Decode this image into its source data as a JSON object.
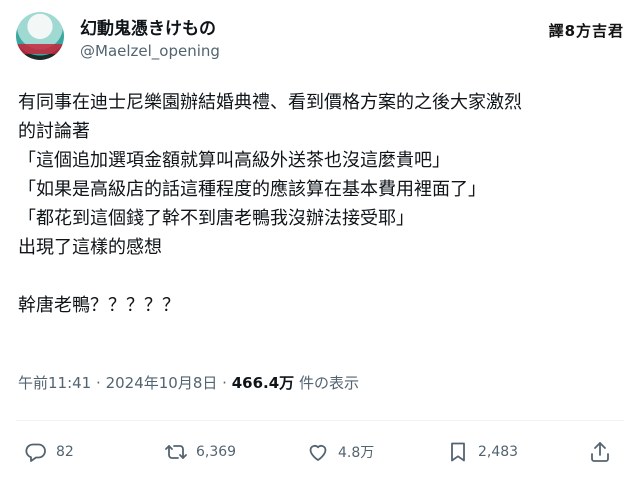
{
  "author": {
    "display_name": "幻動鬼憑きけもの",
    "handle": "@Maelzel_opening"
  },
  "watermark": "譯8方吉君",
  "tweet": {
    "lines": [
      "有同事在迪士尼樂園辦結婚典禮、看到價格方案的之後大家激烈",
      "的討論著",
      "「這個追加選項金額就算叫高級外送茶也沒這麼貴吧」",
      "「如果是高級店的話這種程度的應該算在基本費用裡面了」",
      "「都花到這個錢了幹不到唐老鴨我沒辦法接受耶」",
      "出現了這樣的感想",
      "",
      "幹唐老鴨？？？？？"
    ]
  },
  "meta": {
    "time": "午前11:41",
    "date": "2024年10月8日",
    "separator": "·",
    "views_count": "466.4万",
    "views_label": "件の表示"
  },
  "actions": {
    "reply": {
      "icon": "reply-icon",
      "count": "82"
    },
    "retweet": {
      "icon": "retweet-icon",
      "count": "6,369"
    },
    "like": {
      "icon": "heart-icon",
      "count": "4.8万"
    },
    "bookmark": {
      "icon": "bookmark-icon",
      "count": "2,483"
    },
    "share": {
      "icon": "share-icon"
    }
  }
}
